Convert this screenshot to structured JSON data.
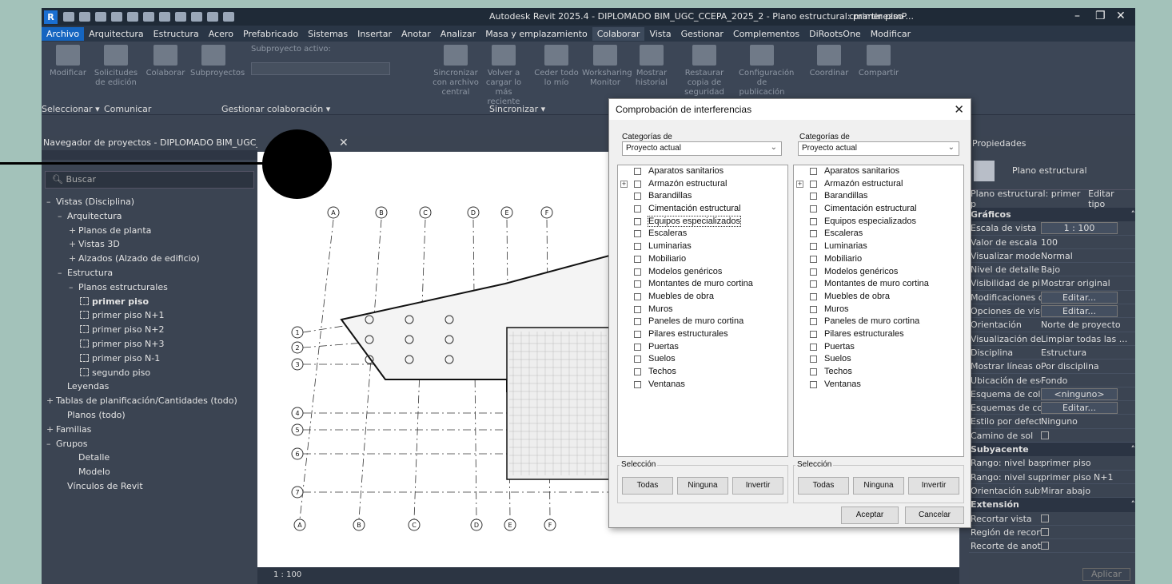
{
  "titlebar": {
    "title": "Autodesk Revit 2025.4 - DIPLOMADO BIM_UGC_CCEPA_2025_2 - Plano estructural: primer piso",
    "user": "cmartinezmP..."
  },
  "menu": [
    "Archivo",
    "Arquitectura",
    "Estructura",
    "Acero",
    "Prefabricado",
    "Sistemas",
    "Insertar",
    "Anotar",
    "Analizar",
    "Masa y emplazamiento",
    "Colaborar",
    "Vista",
    "Gestionar",
    "Complementos",
    "DiRootsOne",
    "Modificar"
  ],
  "active_menu": "Colaborar",
  "ribbon": {
    "buttons": [
      {
        "label": "Modificar"
      },
      {
        "label": "Solicitudes de edición"
      },
      {
        "label": "Colaborar"
      },
      {
        "label": "Subproyectos"
      },
      {
        "label": "Sincronizar con archivo central"
      },
      {
        "label": "Volver a cargar lo más reciente"
      },
      {
        "label": "Ceder todo lo mío"
      },
      {
        "label": "Worksharing Monitor"
      },
      {
        "label": "Mostrar historial"
      },
      {
        "label": "Restaurar copia de seguridad"
      },
      {
        "label": "Configuración de publicación"
      },
      {
        "label": "Coordinar"
      },
      {
        "label": "Compartir"
      }
    ],
    "active_workset_label": "Subproyecto activo:",
    "groups": [
      "Seleccionar ▾",
      "Comunicar",
      "Gestionar colaboración ▾",
      "Sincronizar ▾"
    ]
  },
  "browser": {
    "header": "Navegador de proyectos - DIPLOMADO BIM_UGC_CC...",
    "search_placeholder": "Buscar",
    "items": [
      {
        "t": "–",
        "label": "Vistas (Disciplina)",
        "indent": 0
      },
      {
        "t": "–",
        "label": "Arquitectura",
        "indent": 1
      },
      {
        "t": "+",
        "label": "Planos de planta",
        "indent": 2
      },
      {
        "t": "+",
        "label": "Vistas 3D",
        "indent": 2
      },
      {
        "t": "+",
        "label": "Alzados (Alzado de edificio)",
        "indent": 2
      },
      {
        "t": "–",
        "label": "Estructura",
        "indent": 1
      },
      {
        "t": "–",
        "label": "Planos estructurales",
        "indent": 2
      },
      {
        "t": "v",
        "label": "primer piso",
        "indent": 3,
        "bold": true
      },
      {
        "t": "v",
        "label": "primer piso N+1",
        "indent": 3
      },
      {
        "t": "v",
        "label": "primer piso N+2",
        "indent": 3
      },
      {
        "t": "v",
        "label": "primer piso N+3",
        "indent": 3
      },
      {
        "t": "v",
        "label": "primer piso N-1",
        "indent": 3
      },
      {
        "t": "v",
        "label": "segundo piso",
        "indent": 3
      },
      {
        "t": "",
        "label": "Leyendas",
        "indent": 1
      },
      {
        "t": "+",
        "label": "Tablas de planificación/Cantidades (todo)",
        "indent": 0
      },
      {
        "t": "",
        "label": "Planos (todo)",
        "indent": 1
      },
      {
        "t": "+",
        "label": "Familias",
        "indent": 0
      },
      {
        "t": "–",
        "label": "Grupos",
        "indent": 0
      },
      {
        "t": "",
        "label": "Detalle",
        "indent": 2
      },
      {
        "t": "",
        "label": "Modelo",
        "indent": 2
      },
      {
        "t": "",
        "label": "Vínculos de Revit",
        "indent": 1
      }
    ]
  },
  "canvas": {
    "scale": "1 : 100",
    "grid_top": [
      "A",
      "B",
      "C",
      "D",
      "E",
      "F"
    ],
    "grid_left": [
      "1",
      "2",
      "3",
      "4",
      "5",
      "6",
      "7"
    ]
  },
  "dialog": {
    "title": "Comprobación de interferencias",
    "categories_label": "Categorías de",
    "left_source": "Proyecto actual",
    "right_source": "Proyecto actual",
    "categories": [
      "Aparatos sanitarios",
      "Armazón estructural",
      "Barandillas",
      "Cimentación estructural",
      "Equipos especializados",
      "Escaleras",
      "Luminarias",
      "Mobiliario",
      "Modelos genéricos",
      "Montantes de muro cortina",
      "Muebles de obra",
      "Muros",
      "Paneles de muro cortina",
      "Pilares estructurales",
      "Puertas",
      "Suelos",
      "Techos",
      "Ventanas"
    ],
    "selection_label": "Selección",
    "all": "Todas",
    "none": "Ninguna",
    "invert": "Invertir",
    "ok": "Aceptar",
    "cancel": "Cancelar"
  },
  "properties": {
    "header": "Propiedades",
    "type_name": "Plano estructural",
    "instance_selector": "Plano estructural: primer p",
    "edit_type": "Editar tipo",
    "sections": [
      {
        "name": "Gráficos",
        "rows": [
          [
            "Escala de vista",
            "1 : 100"
          ],
          [
            "Valor de escala ...",
            "100"
          ],
          [
            "Visualizar modelo",
            "Normal"
          ],
          [
            "Nivel de detalle",
            "Bajo"
          ],
          [
            "Visibilidad de pi...",
            "Mostrar original"
          ],
          [
            "Modificaciones d...",
            "Editar..."
          ],
          [
            "Opciones de visu...",
            "Editar..."
          ],
          [
            "Orientación",
            "Norte de proyecto"
          ],
          [
            "Visualización de ...",
            "Limpiar todas las ..."
          ],
          [
            "Disciplina",
            "Estructura"
          ],
          [
            "Mostrar líneas oc...",
            "Por disciplina"
          ],
          [
            "Ubicación de esq...",
            "Fondo"
          ],
          [
            "Esquema de color",
            "<ninguno>"
          ],
          [
            "Esquemas de col...",
            "Editar..."
          ],
          [
            "Estilo por defect...",
            "Ninguno"
          ],
          [
            "Camino de sol",
            ""
          ]
        ]
      },
      {
        "name": "Subyacente",
        "rows": [
          [
            "Rango: nivel base",
            "primer piso"
          ],
          [
            "Rango: nivel sup...",
            "primer piso N+1"
          ],
          [
            "Orientación suby...",
            "Mirar abajo"
          ]
        ]
      },
      {
        "name": "Extensión",
        "rows": [
          [
            "Recortar vista",
            ""
          ],
          [
            "Región de recort...",
            ""
          ],
          [
            "Recorte de anota...",
            ""
          ]
        ]
      }
    ],
    "apply": "Aplicar"
  }
}
